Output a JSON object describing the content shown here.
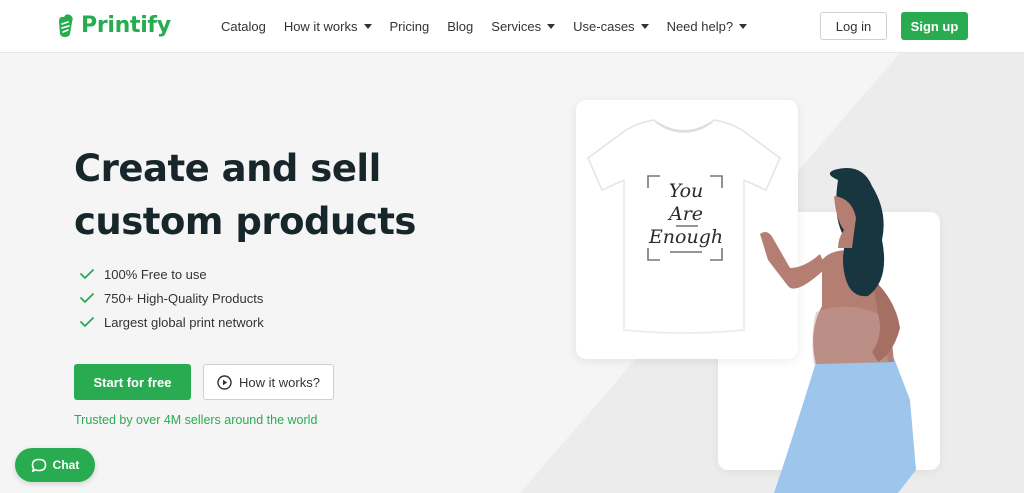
{
  "header": {
    "logo_text": "Printify",
    "nav": [
      {
        "label": "Catalog",
        "dropdown": false
      },
      {
        "label": "How it works",
        "dropdown": true
      },
      {
        "label": "Pricing",
        "dropdown": false
      },
      {
        "label": "Blog",
        "dropdown": false
      },
      {
        "label": "Services",
        "dropdown": true
      },
      {
        "label": "Use-cases",
        "dropdown": true
      },
      {
        "label": "Need help?",
        "dropdown": true
      }
    ],
    "login_label": "Log in",
    "signup_label": "Sign up"
  },
  "hero": {
    "title_line1": "Create and sell",
    "title_line2": "custom products",
    "features": [
      "100% Free to use",
      "750+ High-Quality Products",
      "Largest global print network"
    ],
    "start_label": "Start for free",
    "how_label": "How it works?",
    "trusted_text": "Trusted by over 4M sellers around the world"
  },
  "tshirt_print": [
    "You",
    "Are",
    "Enough"
  ],
  "chat": {
    "label": "Chat"
  },
  "colors": {
    "brand_green": "#29ab51",
    "text_dark": "#17262b",
    "hair": "#17363f",
    "skin": "#b47f72",
    "skirt": "#9ec6ec"
  },
  "icons": [
    "logo-icon",
    "chevron-down-icon",
    "check-icon",
    "play-circle-icon",
    "chat-bubble-icon"
  ]
}
